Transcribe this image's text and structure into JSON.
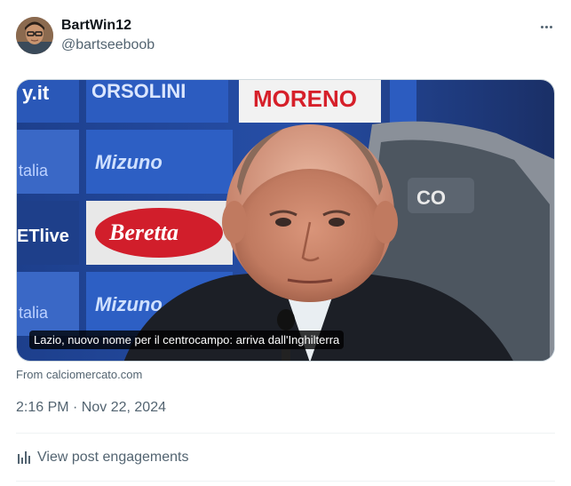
{
  "author": {
    "display_name": "BartWin12",
    "handle": "@bartseeboob"
  },
  "media": {
    "caption": "Lazio, nuovo nome per il centrocampo: arriva dall'Inghilterra",
    "backdrop_sponsors": [
      "y.it",
      "ORSOLINI",
      "MORENO",
      "Mizuno",
      "Beretta",
      "talia",
      "ET live",
      "CO"
    ]
  },
  "source": "From calciomercato.com",
  "timestamp": "2:16 PM · Nov 22, 2024",
  "engagements_label": "View post engagements",
  "icons": [
    "more-options-icon",
    "analytics-bars-icon"
  ]
}
